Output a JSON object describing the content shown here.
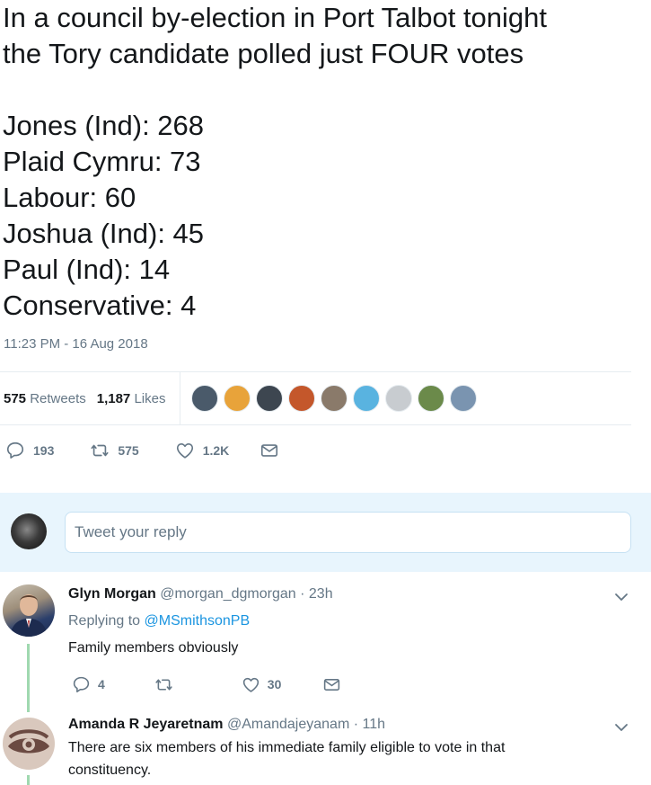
{
  "tweet": {
    "intro_line1": "In a council by-election in Port Talbot tonight",
    "intro_line2": "the Tory candidate polled just FOUR votes",
    "results": [
      "Jones (Ind): 268",
      "Plaid Cymru: 73",
      "Labour: 60",
      "Joshua (Ind): 45",
      "Paul (Ind): 14",
      "Conservative: 4"
    ],
    "timestamp": "11:23 PM - 16 Aug 2018"
  },
  "stats": {
    "retweets_count": "575",
    "retweets_label": "Retweets",
    "likes_count": "1,187",
    "likes_label": "Likes",
    "liker_avatar_colors": [
      "#4a5a6a",
      "#e8a33a",
      "#3d4650",
      "#c4572b",
      "#8a7a6a",
      "#59b3e0",
      "#c8ccd0",
      "#6b8a4a",
      "#7a94b0"
    ]
  },
  "actions": {
    "replies": "193",
    "retweets": "575",
    "likes": "1.2K"
  },
  "reply_box": {
    "placeholder": "Tweet your reply"
  },
  "replies": [
    {
      "name": "Glyn Morgan",
      "handle": "@morgan_dgmorgan",
      "time": "· 23h",
      "replying_prefix": "Replying to",
      "replying_to": "@MSmithsonPB",
      "text": "Family members obviously",
      "reply_count": "4",
      "retweet_count": "",
      "like_count": "30"
    },
    {
      "name": "Amanda R Jeyaretnam",
      "handle": "@Amandajeyanam",
      "time": "· 11h",
      "text": "There are six members of his immediate family eligible to vote in that constituency."
    }
  ],
  "colors": {
    "primary_text": "#14171a",
    "secondary_text": "#657786",
    "link": "#1b95e0",
    "reply_bg": "#e8f5fd",
    "thread_line": "#a0d9b0"
  }
}
